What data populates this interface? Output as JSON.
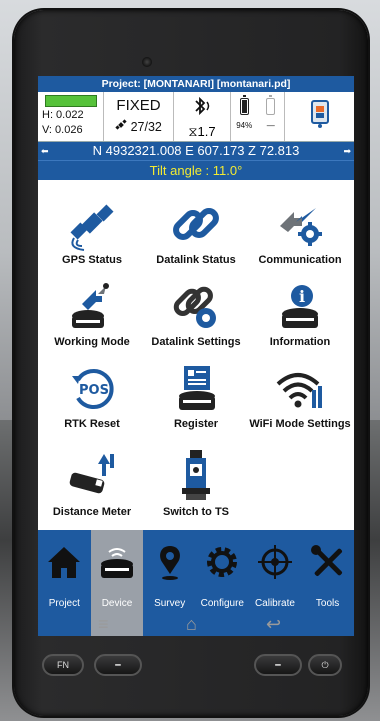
{
  "header": {
    "title": "Project: [MONTANARI] [montanari.pd]"
  },
  "status": {
    "h_precision": "H: 0.022",
    "v_precision": "V: 0.026",
    "fix_state": "FIXED",
    "satellites": "27/32",
    "link_age": "1.7",
    "battery_1_level": "94%",
    "battery_2_level": "—",
    "precision_color": "#56c23a"
  },
  "position": {
    "coordinates": "N 4932321.008 E 607.173 Z 72.813",
    "tilt": "Tilt angle : 11.0°"
  },
  "menu": [
    {
      "label": "GPS Status",
      "icon": "satellite-icon"
    },
    {
      "label": "Datalink Status",
      "icon": "link-icon"
    },
    {
      "label": "Communication",
      "icon": "communication-icon"
    },
    {
      "label": "Working Mode",
      "icon": "working-mode-icon"
    },
    {
      "label": "Datalink Settings",
      "icon": "link-settings-icon"
    },
    {
      "label": "Information",
      "icon": "info-icon"
    },
    {
      "label": "RTK Reset",
      "icon": "pos-reset-icon"
    },
    {
      "label": "Register",
      "icon": "register-icon"
    },
    {
      "label": "WiFi Mode Settings",
      "icon": "wifi-icon"
    },
    {
      "label": "Distance Meter",
      "icon": "distance-meter-icon"
    },
    {
      "label": "Switch to TS",
      "icon": "total-station-icon"
    }
  ],
  "nav": [
    {
      "label": "Project",
      "icon": "home-icon"
    },
    {
      "label": "Device",
      "icon": "receiver-icon",
      "active": true
    },
    {
      "label": "Survey",
      "icon": "map-pin-icon"
    },
    {
      "label": "Configure",
      "icon": "gear-icon"
    },
    {
      "label": "Calibrate",
      "icon": "crosshair-icon"
    },
    {
      "label": "Tools",
      "icon": "tools-icon"
    }
  ],
  "hardware": {
    "fn_label": "FN"
  },
  "colors": {
    "accent": "#1e5aa0",
    "tilt_text": "#f2ea33",
    "active_tab": "#9aa0a8"
  }
}
